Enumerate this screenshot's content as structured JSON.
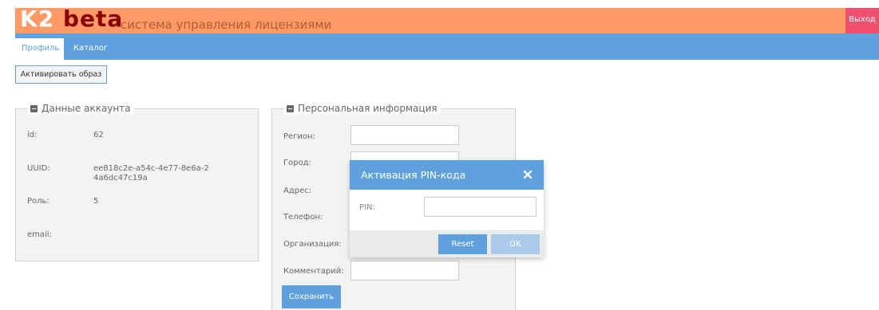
{
  "header": {
    "logo_k2": "K2",
    "logo_beta": "beta",
    "subtitle": "система управления лицензиями",
    "logout_label": "Выход"
  },
  "nav": {
    "tabs": [
      {
        "label": "Профиль",
        "active": true
      },
      {
        "label": "Каталог",
        "active": false
      }
    ]
  },
  "toolbar": {
    "activate_label": "Активировать образ"
  },
  "account": {
    "legend": "Данные аккаунта",
    "fields": [
      {
        "label": "id:",
        "value": "62"
      },
      {
        "label": "UUID:",
        "value": "ee818c2e-a54c-4e77-8e6a-24a6dc47c19a"
      },
      {
        "label": "Роль:",
        "value": "5"
      },
      {
        "label": "email:",
        "value": ""
      }
    ]
  },
  "personal": {
    "legend": "Персональная информация",
    "fields": [
      {
        "label": "Регион:",
        "value": ""
      },
      {
        "label": "Город:",
        "value": ""
      },
      {
        "label": "Адрес:",
        "value": ""
      },
      {
        "label": "Телефон:",
        "value": ""
      },
      {
        "label": "Организация:",
        "value": ""
      },
      {
        "label": "Комментарий:",
        "value": ""
      }
    ],
    "save_label": "Сохранить"
  },
  "modal": {
    "title": "Активация PIN-кода",
    "pin_label": "PIN:",
    "pin_value": "",
    "reset_label": "Reset",
    "ok_label": "OK"
  },
  "colors": {
    "header_bg": "#ff9966",
    "logo_beta": "#8b0000",
    "logout_bg": "#f0506e",
    "primary": "#5ea1dc",
    "ok_disabled": "#aacbea",
    "panel_bg": "#f3f3f3"
  }
}
